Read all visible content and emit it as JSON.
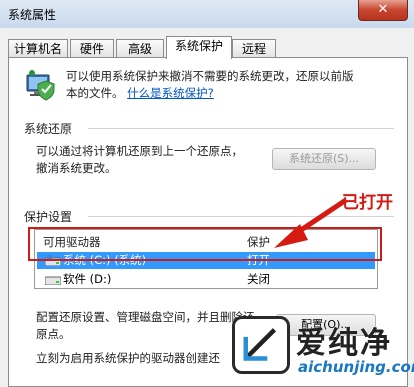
{
  "window": {
    "title": "系统属性",
    "close_label": "✕"
  },
  "tabs": [
    {
      "label": "计算机名",
      "active": false
    },
    {
      "label": "硬件",
      "active": false
    },
    {
      "label": "高级",
      "active": false
    },
    {
      "label": "系统保护",
      "active": true
    },
    {
      "label": "远程",
      "active": false
    }
  ],
  "intro": {
    "text_line1": "可以使用系统保护来撤消不需要的系统更改，还原以前版",
    "text_line2": "本的文件。",
    "link": "什么是系统保护?",
    "icon": "shield-computer-icon"
  },
  "restore": {
    "group_title": "系统还原",
    "text_line1": "可以通过将计算机还原到上一个还原点，",
    "text_line2": "撤消系统更改。",
    "button_label": "系统还原(S)..."
  },
  "protection": {
    "group_title": "保护设置",
    "columns": [
      "可用驱动器",
      "保护"
    ],
    "drives": [
      {
        "name": "系统 (C:) (系统)",
        "status": "打开",
        "selected": true,
        "icon": "system-drive-icon"
      },
      {
        "name": "软件 (D:)",
        "status": "关闭",
        "selected": false,
        "icon": "drive-icon"
      }
    ]
  },
  "configure": {
    "text_line1": "配置还原设置、管理磁盘空间，并且删除还",
    "text_line2": "原点。",
    "button_label": "配置(O)..."
  },
  "create": {
    "text": "立刻为启用系统保护的驱动器创建还"
  },
  "annotation": {
    "label": "已打开",
    "color": "#d61a12"
  },
  "watermark": {
    "big": "爱纯净",
    "small": "aichunjing.com"
  }
}
